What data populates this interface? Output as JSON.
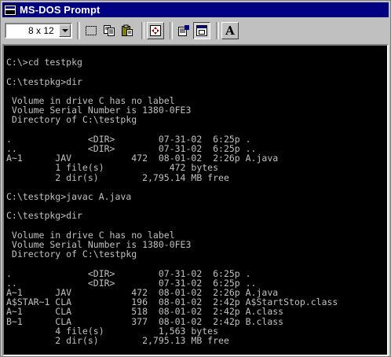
{
  "window": {
    "title": "MS-DOS Prompt"
  },
  "toolbar": {
    "font_size": "8 x 12",
    "buttons": [
      {
        "name": "mark-icon"
      },
      {
        "name": "copy-icon"
      },
      {
        "name": "paste-icon"
      },
      {
        "name": "fullscreen-icon"
      },
      {
        "name": "properties-icon"
      },
      {
        "name": "background-icon"
      },
      {
        "name": "font-icon",
        "label": "A"
      }
    ]
  },
  "console": {
    "lines": [
      "",
      "C:\\>cd testpkg",
      "",
      "C:\\testpkg>dir",
      "",
      " Volume in drive C has no label",
      " Volume Serial Number is 1380-0FE3",
      " Directory of C:\\testpkg",
      "",
      ".              <DIR>        07-31-02  6:25p .",
      "..             <DIR>        07-31-02  6:25p ..",
      "A~1      JAV           472  08-01-02  2:26p A.java",
      "         1 file(s)            472 bytes",
      "         2 dir(s)        2,795.14 MB free",
      "",
      "C:\\testpkg>javac A.java",
      "",
      "C:\\testpkg>dir",
      "",
      " Volume in drive C has no label",
      " Volume Serial Number is 1380-0FE3",
      " Directory of C:\\testpkg",
      "",
      ".              <DIR>        07-31-02  6:25p .",
      "..             <DIR>        07-31-02  6:25p ..",
      "A~1      JAV           472  08-01-02  2:26p A.java",
      "A$STAR~1 CLA           196  08-01-02  2:42p A$StartStop.class",
      "A~1      CLA           518  08-01-02  2:42p A.class",
      "B~1      CLA           377  08-01-02  2:42p B.class",
      "         4 file(s)          1,563 bytes",
      "         2 dir(s)        2,795.13 MB free",
      "",
      "C:\\testpkg>"
    ]
  }
}
